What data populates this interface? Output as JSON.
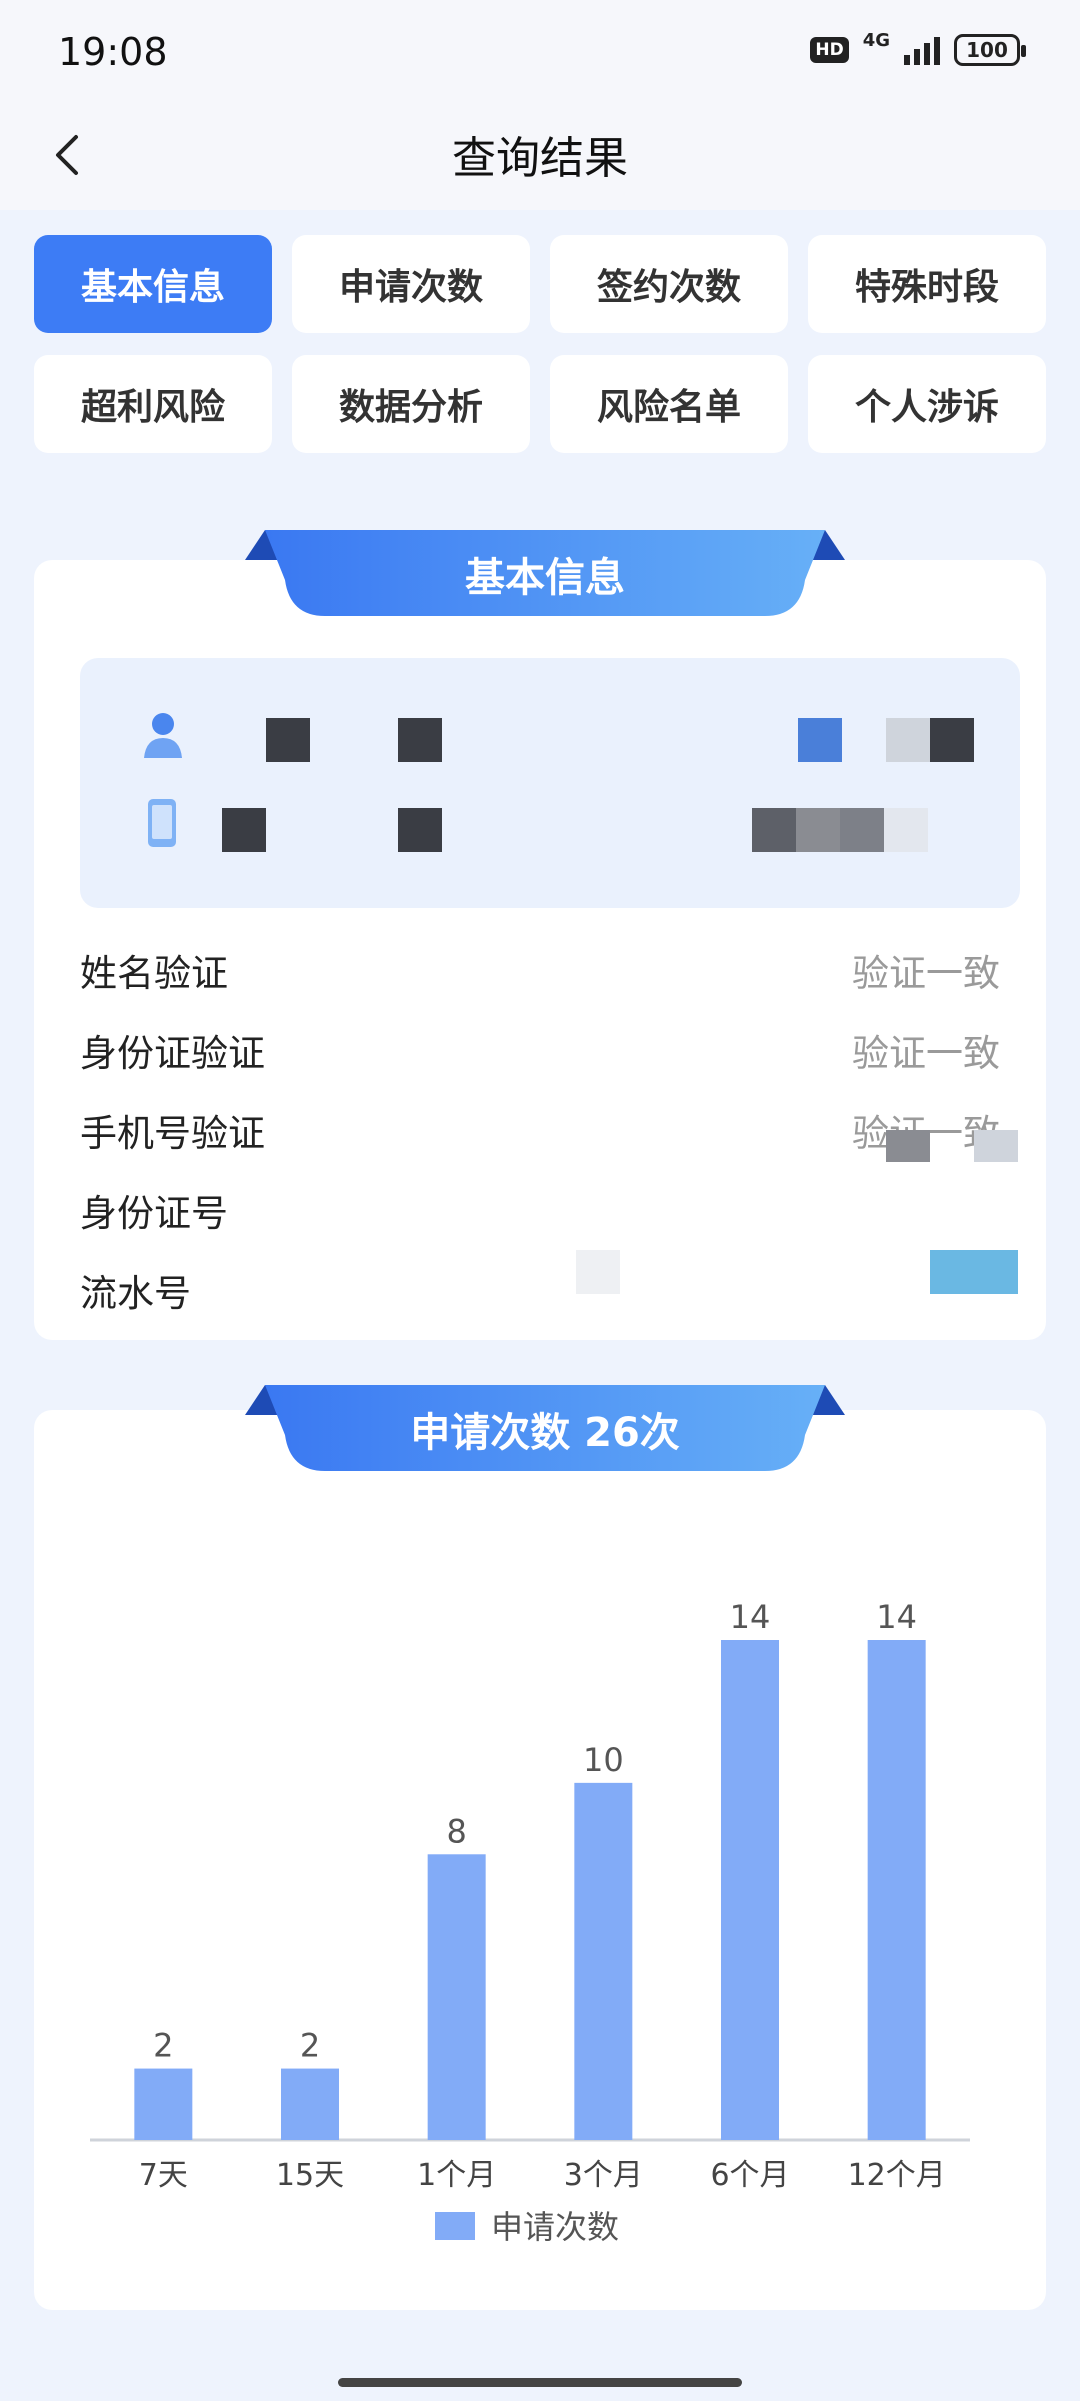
{
  "status_bar": {
    "time": "19:08",
    "hd": "HD",
    "network": "4G",
    "battery": "100"
  },
  "header": {
    "title": "查询结果"
  },
  "tabs": [
    {
      "label": "基本信息",
      "active": true
    },
    {
      "label": "申请次数",
      "active": false
    },
    {
      "label": "签约次数",
      "active": false
    },
    {
      "label": "特殊时段",
      "active": false
    },
    {
      "label": "超利风险",
      "active": false
    },
    {
      "label": "数据分析",
      "active": false
    },
    {
      "label": "风险名单",
      "active": false
    },
    {
      "label": "个人涉诉",
      "active": false
    }
  ],
  "basic_info": {
    "title": "基本信息",
    "rows": [
      {
        "label": "姓名验证",
        "value": "验证一致"
      },
      {
        "label": "身份证验证",
        "value": "验证一致"
      },
      {
        "label": "手机号验证",
        "value": "验证一致"
      },
      {
        "label": "身份证号",
        "value": ""
      },
      {
        "label": "流水号",
        "value": ""
      }
    ]
  },
  "applications": {
    "title": "申请次数 26次"
  },
  "chart_data": {
    "type": "bar",
    "categories": [
      "7天",
      "15天",
      "1个月",
      "3个月",
      "6个月",
      "12个月"
    ],
    "series": [
      {
        "name": "申请次数",
        "values": [
          2,
          2,
          8,
          10,
          14,
          14
        ]
      }
    ],
    "ylim": [
      0,
      14
    ],
    "legend": "bottom",
    "bar_color": "#82abf7",
    "grid": false
  },
  "colors": {
    "accent": "#3d7cf5",
    "bar": "#82abf7",
    "ribbon_start": "#3a78f2",
    "ribbon_end": "#67b0f7"
  }
}
